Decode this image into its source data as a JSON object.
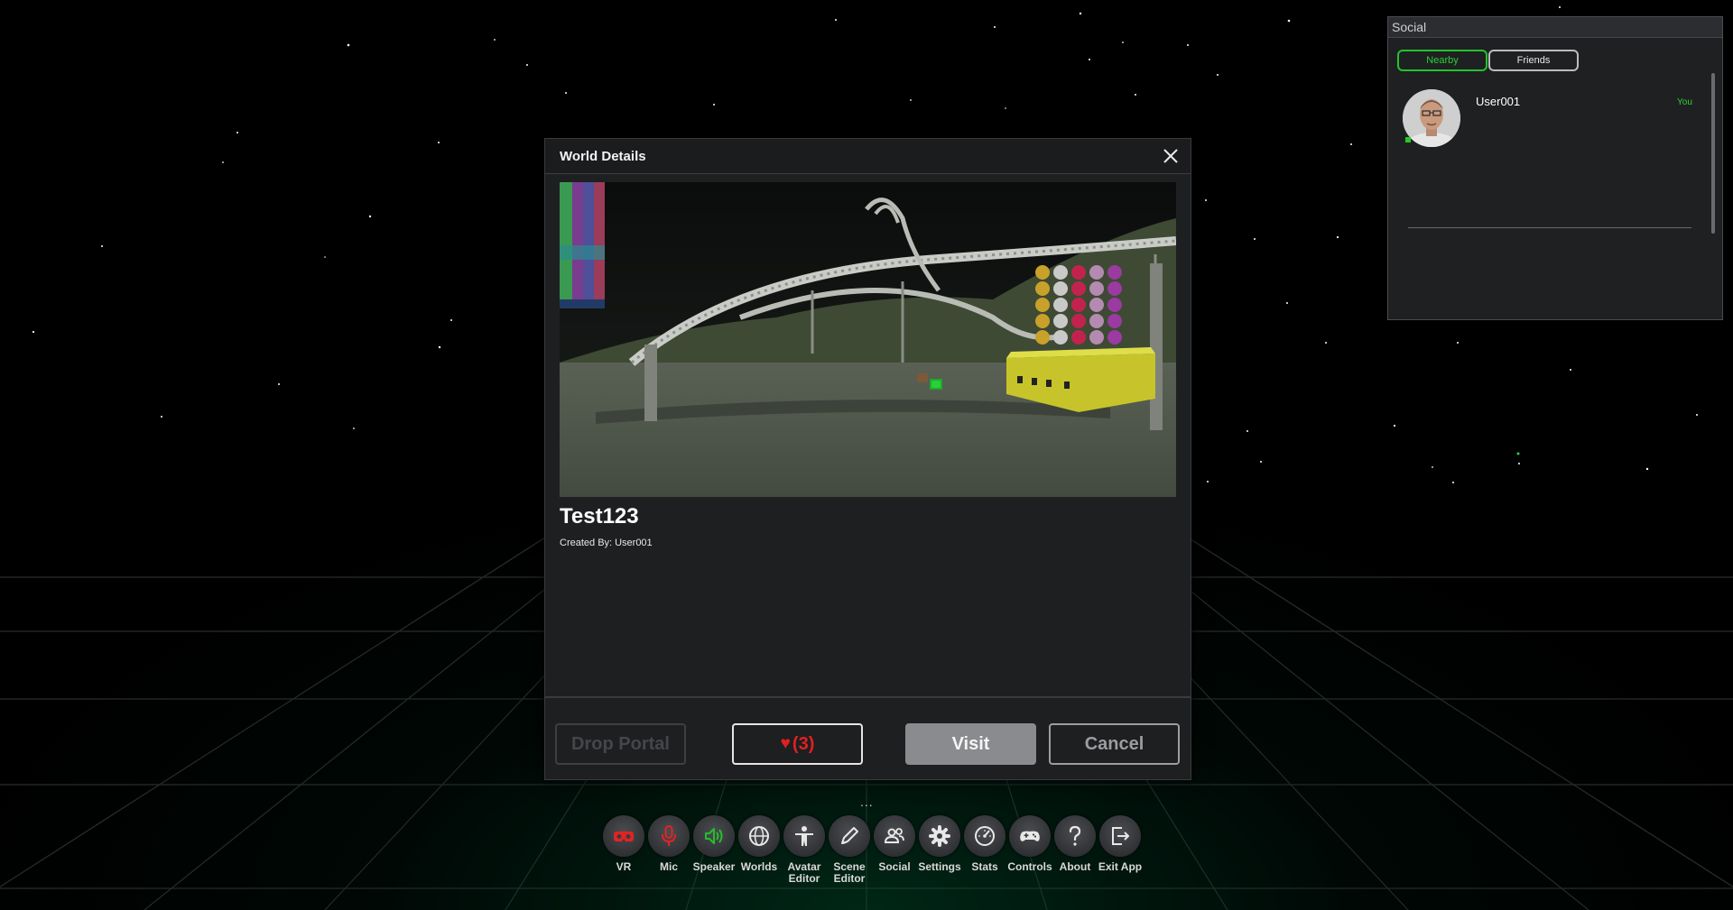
{
  "dialog": {
    "title": "World Details",
    "world_name": "Test123",
    "created_by_label": "Created By:",
    "creator": "User001",
    "buttons": {
      "drop_portal": "Drop Portal",
      "like_heart": "♥",
      "like_count": "(3)",
      "visit": "Visit",
      "cancel": "Cancel"
    }
  },
  "social": {
    "title": "Social",
    "tabs": {
      "nearby": "Nearby",
      "friends": "Friends"
    },
    "users": [
      {
        "name": "User001",
        "badge": "You",
        "online": true
      }
    ]
  },
  "toolbar": {
    "more": "...",
    "items": [
      {
        "label": "VR",
        "icon": "vr-headset-icon"
      },
      {
        "label": "Mic",
        "icon": "microphone-icon"
      },
      {
        "label": "Speaker",
        "icon": "speaker-icon"
      },
      {
        "label": "Worlds",
        "icon": "globe-icon"
      },
      {
        "label": "Avatar Editor",
        "icon": "avatar-person-icon"
      },
      {
        "label": "Scene Editor",
        "icon": "pencil-icon"
      },
      {
        "label": "Social",
        "icon": "users-icon"
      },
      {
        "label": "Settings",
        "icon": "gear-icon"
      },
      {
        "label": "Stats",
        "icon": "speedometer-icon"
      },
      {
        "label": "Controls",
        "icon": "gamepad-icon"
      },
      {
        "label": "About",
        "icon": "question-icon"
      },
      {
        "label": "Exit App",
        "icon": "exit-icon"
      }
    ]
  },
  "colors": {
    "accent_green": "#29d132",
    "mic_red": "#e02424",
    "speaker_green": "#22c02a",
    "like_red": "#e02020"
  }
}
